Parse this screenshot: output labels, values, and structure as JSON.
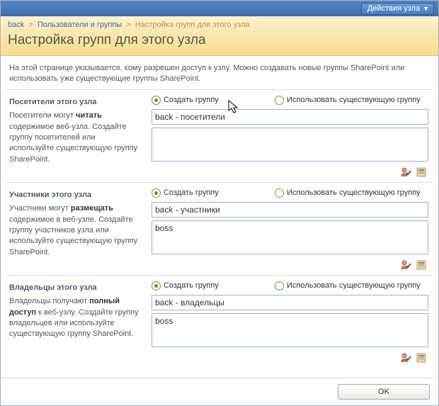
{
  "topbar": {
    "site_actions_label": "Действия узла"
  },
  "breadcrumb": {
    "root": "back",
    "mid": "Пользователи и группы",
    "current": "Настройка групп для этого узла"
  },
  "page_title": "Настройка групп для этого узла",
  "description": "На этой странице указывается, кому разрешен доступ к узлу. Можно создавать новые группы SharePoint или использовать уже существующие группы SharePoint.",
  "radio_labels": {
    "create": "Создать группу",
    "use_existing": "Использовать существующую группу"
  },
  "sections": [
    {
      "title": "Посетители этого узла",
      "desc_pre": "Посетители могут ",
      "desc_bold": "читать",
      "desc_post": " содержимое веб-узла. Создайте группу посетителей или используйте существующую группу SharePoint.",
      "create_selected": true,
      "group_name": "back - посетители",
      "members": ""
    },
    {
      "title": "Участники этого узла",
      "desc_pre": "Участники могут ",
      "desc_bold": "размещать",
      "desc_post": " содержимое в веб-узле. Создайте группу участников узла или используйте существующую группу SharePoint.",
      "create_selected": true,
      "group_name": "back - участники",
      "members": "boss"
    },
    {
      "title": "Владельцы этого узла",
      "desc_pre": "Владельцы получают ",
      "desc_bold": "полный доступ",
      "desc_post": " к веб-узлу. Создайте группу владельцев или используйте существующую группу SharePoint.",
      "create_selected": true,
      "group_name": "back - владельцы",
      "members": "boss"
    }
  ],
  "footer": {
    "ok_label": "OK"
  },
  "icons": {
    "check_names": "check-names-icon",
    "browse": "address-book-icon"
  }
}
